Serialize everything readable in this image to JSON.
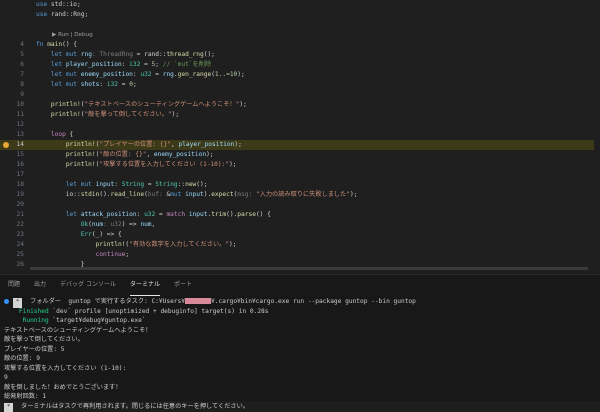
{
  "editor": {
    "lines": [
      {
        "num": "",
        "parts": [
          [
            "kw",
            "use"
          ],
          [
            "pl",
            " std::io;"
          ]
        ]
      },
      {
        "num": "",
        "parts": [
          [
            "kw",
            "use"
          ],
          [
            "pl",
            " rand::Rng;"
          ]
        ]
      },
      {
        "num": "",
        "parts": []
      },
      {
        "num": "",
        "lens": "▶ Run | Debug",
        "parts": []
      },
      {
        "num": "4",
        "parts": [
          [
            "kw",
            "fn"
          ],
          [
            "pl",
            " "
          ],
          [
            "fn",
            "main"
          ],
          [
            "pl",
            "() {"
          ]
        ]
      },
      {
        "num": "5",
        "parts": [
          [
            "pl",
            "    "
          ],
          [
            "kw",
            "let"
          ],
          [
            "pl",
            " "
          ],
          [
            "kw",
            "mut"
          ],
          [
            "pl",
            " "
          ],
          [
            "var",
            "rng"
          ],
          [
            "hint",
            ": ThreadRng"
          ],
          [
            "pl",
            " = rand::"
          ],
          [
            "fn",
            "thread_rng"
          ],
          [
            "pl",
            "();"
          ]
        ]
      },
      {
        "num": "6",
        "parts": [
          [
            "pl",
            "    "
          ],
          [
            "kw",
            "let"
          ],
          [
            "pl",
            " "
          ],
          [
            "var",
            "player_position"
          ],
          [
            "pl",
            ": "
          ],
          [
            "ty",
            "i32"
          ],
          [
            "pl",
            " = "
          ],
          [
            "num",
            "5"
          ],
          [
            "pl",
            "; "
          ],
          [
            "cm",
            "// `mut`を削除"
          ]
        ]
      },
      {
        "num": "7",
        "parts": [
          [
            "pl",
            "    "
          ],
          [
            "kw",
            "let"
          ],
          [
            "pl",
            " "
          ],
          [
            "kw",
            "mut"
          ],
          [
            "pl",
            " "
          ],
          [
            "var",
            "enemy_position"
          ],
          [
            "pl",
            ": "
          ],
          [
            "ty",
            "u32"
          ],
          [
            "pl",
            " = "
          ],
          [
            "var",
            "rng"
          ],
          [
            "pl",
            "."
          ],
          [
            "fn",
            "gen_range"
          ],
          [
            "pl",
            "("
          ],
          [
            "num",
            "1..=10"
          ],
          [
            "pl",
            ");"
          ]
        ]
      },
      {
        "num": "8",
        "parts": [
          [
            "pl",
            "    "
          ],
          [
            "kw",
            "let"
          ],
          [
            "pl",
            " "
          ],
          [
            "kw",
            "mut"
          ],
          [
            "pl",
            " "
          ],
          [
            "var",
            "shots"
          ],
          [
            "pl",
            ": "
          ],
          [
            "ty",
            "i32"
          ],
          [
            "pl",
            " = "
          ],
          [
            "num",
            "0"
          ],
          [
            "pl",
            ";"
          ]
        ]
      },
      {
        "num": "9",
        "parts": []
      },
      {
        "num": "10",
        "parts": [
          [
            "pl",
            "    "
          ],
          [
            "mac",
            "println!"
          ],
          [
            "pl",
            "("
          ],
          [
            "str",
            "\"テキストベースのシューティングゲームへようこそ！\""
          ],
          [
            "pl",
            ");"
          ]
        ]
      },
      {
        "num": "11",
        "parts": [
          [
            "pl",
            "    "
          ],
          [
            "mac",
            "println!"
          ],
          [
            "pl",
            "("
          ],
          [
            "str",
            "\"敵を撃って倒してください。\""
          ],
          [
            "pl",
            ");"
          ]
        ]
      },
      {
        "num": "12",
        "parts": []
      },
      {
        "num": "13",
        "parts": [
          [
            "pl",
            "    "
          ],
          [
            "kw2",
            "loop"
          ],
          [
            "pl",
            " {"
          ]
        ]
      },
      {
        "num": "14",
        "bp": true,
        "parts": [
          [
            "pl",
            "        "
          ],
          [
            "mac",
            "println!"
          ],
          [
            "pl",
            "("
          ],
          [
            "str",
            "\"プレイヤーの位置: {}\""
          ],
          [
            "pl",
            ", "
          ],
          [
            "var",
            "player_position"
          ],
          [
            "pl",
            ");"
          ]
        ]
      },
      {
        "num": "15",
        "parts": [
          [
            "pl",
            "        "
          ],
          [
            "mac",
            "println!"
          ],
          [
            "pl",
            "("
          ],
          [
            "str",
            "\"敵の位置: {}\""
          ],
          [
            "pl",
            ", "
          ],
          [
            "var",
            "enemy_position"
          ],
          [
            "pl",
            ");"
          ]
        ]
      },
      {
        "num": "16",
        "parts": [
          [
            "pl",
            "        "
          ],
          [
            "mac",
            "println!"
          ],
          [
            "pl",
            "("
          ],
          [
            "str",
            "\"攻撃する位置を入力してください (1-10):\""
          ],
          [
            "pl",
            ");"
          ]
        ]
      },
      {
        "num": "17",
        "parts": []
      },
      {
        "num": "18",
        "parts": [
          [
            "pl",
            "        "
          ],
          [
            "kw",
            "let"
          ],
          [
            "pl",
            " "
          ],
          [
            "kw",
            "mut"
          ],
          [
            "pl",
            " "
          ],
          [
            "var",
            "input"
          ],
          [
            "pl",
            ": "
          ],
          [
            "ty",
            "String"
          ],
          [
            "pl",
            " = "
          ],
          [
            "ty",
            "String"
          ],
          [
            "pl",
            "::"
          ],
          [
            "fn",
            "new"
          ],
          [
            "pl",
            "();"
          ]
        ]
      },
      {
        "num": "19",
        "parts": [
          [
            "pl",
            "        io::"
          ],
          [
            "fn",
            "stdin"
          ],
          [
            "pl",
            "()."
          ],
          [
            "fn",
            "read_line"
          ],
          [
            "pl",
            "("
          ],
          [
            "hint",
            "buf: "
          ],
          [
            "pl",
            "&"
          ],
          [
            "kw",
            "mut"
          ],
          [
            "pl",
            " "
          ],
          [
            "var",
            "input"
          ],
          [
            "pl",
            ")."
          ],
          [
            "fn",
            "expect"
          ],
          [
            "pl",
            "("
          ],
          [
            "hint",
            "msg: "
          ],
          [
            "str",
            "\"入力の読み取りに失敗しました\""
          ],
          [
            "pl",
            ");"
          ]
        ]
      },
      {
        "num": "20",
        "parts": []
      },
      {
        "num": "21",
        "parts": [
          [
            "pl",
            "        "
          ],
          [
            "kw",
            "let"
          ],
          [
            "pl",
            " "
          ],
          [
            "var",
            "attack_position"
          ],
          [
            "pl",
            ": "
          ],
          [
            "ty",
            "u32"
          ],
          [
            "pl",
            " = "
          ],
          [
            "kw2",
            "match"
          ],
          [
            "pl",
            " "
          ],
          [
            "var",
            "input"
          ],
          [
            "pl",
            "."
          ],
          [
            "fn",
            "trim"
          ],
          [
            "pl",
            "()."
          ],
          [
            "fn",
            "parse"
          ],
          [
            "pl",
            "() {"
          ]
        ]
      },
      {
        "num": "22",
        "parts": [
          [
            "pl",
            "            "
          ],
          [
            "ty",
            "Ok"
          ],
          [
            "pl",
            "("
          ],
          [
            "var",
            "num"
          ],
          [
            "hint",
            ": u32"
          ],
          [
            "pl",
            ") => "
          ],
          [
            "var",
            "num"
          ],
          [
            "pl",
            ","
          ]
        ]
      },
      {
        "num": "23",
        "parts": [
          [
            "pl",
            "            "
          ],
          [
            "ty",
            "Err"
          ],
          [
            "pl",
            "(_) => {"
          ]
        ]
      },
      {
        "num": "24",
        "parts": [
          [
            "pl",
            "                "
          ],
          [
            "mac",
            "println!"
          ],
          [
            "pl",
            "("
          ],
          [
            "str",
            "\"有効な数字を入力してください。\""
          ],
          [
            "pl",
            ");"
          ]
        ]
      },
      {
        "num": "25",
        "parts": [
          [
            "pl",
            "                "
          ],
          [
            "kw2",
            "continue"
          ],
          [
            "pl",
            ";"
          ]
        ]
      },
      {
        "num": "26",
        "parts": [
          [
            "pl",
            "            }"
          ]
        ]
      },
      {
        "num": "27",
        "parts": [
          [
            "pl",
            "        };"
          ]
        ]
      }
    ]
  },
  "panel": {
    "tabs": [
      "問題",
      "出力",
      "デバッグ コンソール",
      "ターミナル",
      "ポート"
    ],
    "active_tab": "ターミナル"
  },
  "terminal": {
    "task_prefix": " フォルダー  guntop で実行するタスク: C:¥Users¥",
    "task_suffix": "¥.cargo¥bin¥cargo.exe run --package guntop --bin guntop",
    "finished_label": "    Finished",
    "finished_text": " `dev` profile [unoptimized + debuginfo] target(s) in 0.28s",
    "running_label": "     Running",
    "running_text": " `target¥debug¥guntop.exe`",
    "output": [
      "テキストベースのシューティングゲームへようこそ！",
      "敵を撃って倒してください。",
      "プレイヤーの位置: 5",
      "敵の位置: 9",
      "攻撃する位置を入力してください (1-10):",
      "9",
      "敵を倒しました！おめでとうございます！",
      "総発射回数: 1"
    ],
    "footer": " ターミナルはタスクで再利用されます。閉じるには任意のキーを押してください。"
  }
}
